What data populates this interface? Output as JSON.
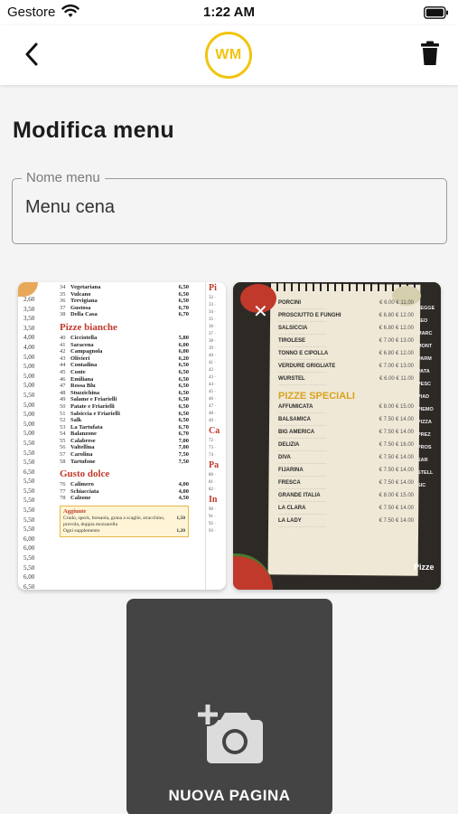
{
  "status_bar": {
    "carrier": "Gestore",
    "time": "1:22 AM"
  },
  "header": {
    "logo_text": "WM",
    "logo_color": "#f1c40f",
    "back_icon": "chevron-left-icon",
    "delete_icon": "trash-icon"
  },
  "title": "Modifica menu",
  "name_field": {
    "label": "Nome menu",
    "value": "Menu cena"
  },
  "pages": [
    {
      "name": "page-1",
      "items_top": [
        [
          "34",
          "Vegetariana",
          "6,50"
        ],
        [
          "35",
          "Vulcano",
          "6,50"
        ],
        [
          "36",
          "Trevigiana",
          "6,50"
        ],
        [
          "37",
          "Gustosa",
          "6,70"
        ],
        [
          "38",
          "Della Casa",
          "6,70"
        ]
      ],
      "heading_1": "Pizze bianche",
      "items_mid": [
        [
          "40",
          "Cicciotella",
          "5,80"
        ],
        [
          "41",
          "Saracena",
          "6,00"
        ],
        [
          "42",
          "Campagnola",
          "6,00"
        ],
        [
          "43",
          "Olivieri",
          "6,20"
        ],
        [
          "44",
          "Contadina",
          "6,50"
        ],
        [
          "45",
          "Conte",
          "6,50"
        ],
        [
          "46",
          "Emiliana",
          "6,50"
        ],
        [
          "47",
          "Rossa Blu",
          "6,50"
        ],
        [
          "48",
          "Stuzzichina",
          "6,50"
        ],
        [
          "49",
          "Salame e Friarielli",
          "6,50"
        ],
        [
          "50",
          "Patate e Friarielli",
          "6,50"
        ],
        [
          "51",
          "Salsiccia e Friarielli",
          "6,50"
        ],
        [
          "52",
          "Salk",
          "6,50"
        ],
        [
          "53",
          "La Tartufata",
          "6,70"
        ],
        [
          "54",
          "Balanzone",
          "6,70"
        ],
        [
          "55",
          "Calabrese",
          "7,00"
        ],
        [
          "56",
          "Valtellina",
          "7,00"
        ],
        [
          "57",
          "Carolina",
          "7,50"
        ],
        [
          "58",
          "Tartufone",
          "7,50"
        ]
      ],
      "heading_2": "Gusto dolce",
      "items_dolce": [
        [
          "76",
          "Calimero",
          "4,00"
        ],
        [
          "77",
          "Schiacciata",
          "4,00"
        ],
        [
          "78",
          "Calzone",
          "4,50"
        ]
      ],
      "extra_title": "Aggiunte",
      "extra_text": "Crudo, speck, bresaola, grana a scaglie, stracchino, provola, doppia mozzarella",
      "extra_prices": "1,50",
      "extra_note": "Ogni supplemento",
      "extra_note_price": "1,20",
      "side_prices": [
        "2,60",
        "3,50",
        "3,50",
        "3,50",
        "4,00",
        "4,00",
        "5,00",
        "5,00",
        "5,00",
        "5,00",
        "5,50",
        "5,00",
        "5,00",
        "5,00",
        "5,00",
        "5,50",
        "5,50",
        "5,50",
        "6,50",
        "5,50",
        "5,50",
        "5,50",
        "5,50",
        "5,50",
        "5,50",
        "6,00",
        "6,00",
        "5,50",
        "5,50",
        "6,00",
        "6,50",
        "6,00",
        "6,50",
        "6,50",
        "6,50"
      ]
    },
    {
      "name": "page-2",
      "items_top": [
        [
          "PORCINI",
          "€ 6.00",
          "€ 11.00"
        ],
        [
          "PROSCIUTTO E FUNGHI",
          "€ 6.80",
          "€ 12.00"
        ],
        [
          "SALSICCIA",
          "€ 6.80",
          "€ 12.00"
        ],
        [
          "TIROLESE",
          "€ 7.00",
          "€ 13.00"
        ],
        [
          "TONNO E CIPOLLA",
          "€ 6.80",
          "€ 12.00"
        ],
        [
          "VERDURE GRIGLIATE",
          "€ 7.00",
          "€ 13.00"
        ],
        [
          "WURSTEL",
          "€ 6.00",
          "€ 11.00"
        ]
      ],
      "heading": "PIZZE SPECIALI",
      "items_special": [
        [
          "AFFUMICATA",
          "€ 8.00",
          "€ 15.00"
        ],
        [
          "BALSAMICA",
          "€ 7.50",
          "€ 14.00"
        ],
        [
          "BIG AMERICA",
          "€ 7.50",
          "€ 14.00"
        ],
        [
          "DELIZIA",
          "€ 7.50",
          "€ 16.00"
        ],
        [
          "DIVA",
          "€ 7.50",
          "€ 14.00"
        ],
        [
          "FIJARINA",
          "€ 7.50",
          "€ 14.00"
        ],
        [
          "FRESCA",
          "€ 7.50",
          "€ 14.00"
        ],
        [
          "GRANDE ITALIA",
          "€ 8.00",
          "€ 15.00"
        ],
        [
          "LA CLARA",
          "€ 7.50",
          "€ 14.00"
        ],
        [
          "LA LADY",
          "€ 7.50",
          "€ 14.00"
        ]
      ],
      "side_items": [
        "LEGGE",
        "LEO",
        "MARC",
        "MONT",
        "PARM",
        "PATA",
        "PESC",
        "PIAD",
        "PIEMO",
        "PIZZA",
        "PREZ",
        "PROS",
        "SAR",
        "STELL",
        "SIC"
      ],
      "footer": "Pizze"
    }
  ],
  "new_page_button": {
    "label": "NUOVA PAGINA",
    "icon": "add-photo-icon"
  }
}
